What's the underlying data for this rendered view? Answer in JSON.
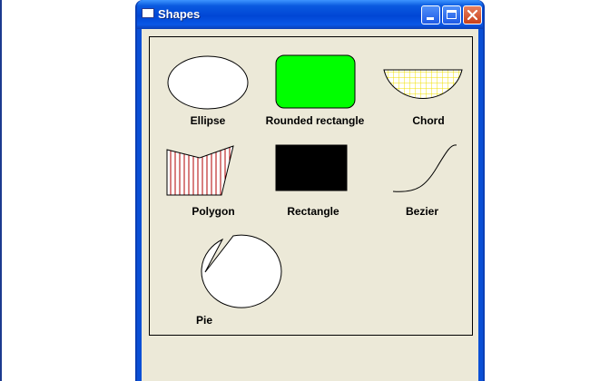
{
  "window": {
    "title": "Shapes"
  },
  "labels": {
    "ellipse": "Ellipse",
    "rounded_rectangle": "Rounded rectangle",
    "chord": "Chord",
    "polygon": "Polygon",
    "rectangle": "Rectangle",
    "bezier": "Bezier",
    "pie": "Pie"
  },
  "colors": {
    "rounded_rectangle_fill": "#00ff00",
    "rectangle_fill": "#000000",
    "chord_hatch": "#f0e000",
    "polygon_hatch": "#b00000",
    "client_background": "#ece9d8"
  },
  "icons": [
    "window-icon",
    "minimize-icon",
    "maximize-icon",
    "close-icon"
  ]
}
